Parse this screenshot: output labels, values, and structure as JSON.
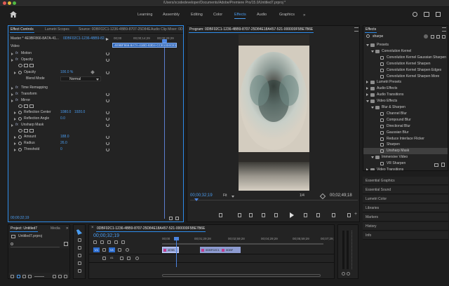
{
  "titlebar": {
    "path": "/Users/xcodedeveloper/Documents/Adobe/Premiere Pro/15.0/Untitled7.prproj *"
  },
  "workspaces": [
    "Learning",
    "Assembly",
    "Editing",
    "Color",
    "Effects",
    "Audio",
    "Graphics"
  ],
  "active_workspace": "Effects",
  "effect_controls": {
    "tabs": [
      "Effect Controls",
      "Lumetri Scopes",
      "Source: 0DBF02C1-1236-4BB9-8707-25D84E18A457-521-0000",
      "Audio Clip Mixer: 0DBF02C1-1236-4BB9-8707-25D84E18A457-521-00008"
    ],
    "source_label": "Master * 4E9BF866-8A7A-41...",
    "seq_label": "0DBF02C1-1236-4BB9-82...",
    "times": [
      "00;00",
      "00;00;14;29",
      "00;00;29;29"
    ],
    "clip_label": "4E9BF866-8A7A-41BD-83D4-CCE1324CE10F",
    "section": "Video",
    "rows": {
      "motion": "Motion",
      "opacity": "Opacity",
      "opacity_label": "Opacity",
      "opacity_value": "100.0 %",
      "blend_label": "Blend Mode",
      "blend_value": "Normal",
      "time_remap": "Time Remapping",
      "transform": "Transform",
      "mirror": "Mirror",
      "refl_center": "Reflection Center",
      "refl_center_x": "1080.0",
      "refl_center_y": "1920.0",
      "refl_angle": "Reflection Angle",
      "refl_angle_value": "0.0",
      "unsharp": "Unsharp Mask",
      "amount": "Amount",
      "amount_value": "188.0",
      "radius": "Radius",
      "radius_value": "26.0",
      "threshold": "Threshold",
      "threshold_value": "0"
    },
    "timecode": "00;00;32;19"
  },
  "program": {
    "title": "Program: 0DBF02C1-1236-4BB9-8707-25D84E18A457-521-000000F5BE7B6E",
    "timecode": "00;00;32;19",
    "fit": "Fit",
    "ratio": "1/4",
    "duration": "00;02;49;18"
  },
  "effects": {
    "title": "Effects",
    "search": "sharpe",
    "items": [
      {
        "label": "Presets",
        "indent": 0,
        "type": "folder",
        "open": true
      },
      {
        "label": "Convolution Kernel",
        "indent": 1,
        "type": "folder",
        "open": true
      },
      {
        "label": "Convolution Kernel Gaussian Sharpen",
        "indent": 2,
        "type": "fx"
      },
      {
        "label": "Convolution Kernel Sharpen",
        "indent": 2,
        "type": "fx"
      },
      {
        "label": "Convolution Kernel Sharpen Edges",
        "indent": 2,
        "type": "fx"
      },
      {
        "label": "Convolution Kernel Sharpen More",
        "indent": 2,
        "type": "fx"
      },
      {
        "label": "Lumetri Presets",
        "indent": 0,
        "type": "folder",
        "open": false
      },
      {
        "label": "Audio Effects",
        "indent": 0,
        "type": "folder",
        "open": false
      },
      {
        "label": "Audio Transitions",
        "indent": 0,
        "type": "folder",
        "open": false
      },
      {
        "label": "Video Effects",
        "indent": 0,
        "type": "folder",
        "open": true
      },
      {
        "label": "Blur & Sharpen",
        "indent": 1,
        "type": "folder",
        "open": true
      },
      {
        "label": "Channel Blur",
        "indent": 2,
        "type": "fx"
      },
      {
        "label": "Compound Blur",
        "indent": 2,
        "type": "fx"
      },
      {
        "label": "Directional Blur",
        "indent": 2,
        "type": "fx"
      },
      {
        "label": "Gaussian Blur",
        "indent": 2,
        "type": "fx"
      },
      {
        "label": "Reduce Interlace Flicker",
        "indent": 2,
        "type": "fx"
      },
      {
        "label": "Sharpen",
        "indent": 2,
        "type": "fx"
      },
      {
        "label": "Unsharp Mask",
        "indent": 2,
        "type": "fx",
        "selected": true
      },
      {
        "label": "Immersive Video",
        "indent": 1,
        "type": "folder",
        "open": true
      },
      {
        "label": "VR Sharpen",
        "indent": 2,
        "type": "fx"
      },
      {
        "label": "Video Transitions",
        "indent": 0,
        "type": "folder",
        "open": false
      }
    ],
    "menu": [
      "Essential Graphics",
      "Essential Sound",
      "Lumetri Color",
      "Libraries",
      "Markers",
      "History",
      "Info"
    ]
  },
  "project": {
    "tabs": [
      "Project: Untitled7",
      "Media"
    ],
    "file": "Untitled7.prproj"
  },
  "timeline": {
    "title": "0DBF02C1-1236-4BB9-8707-25D84E18A457-521-000000F5BE7B6E",
    "timecode": "00;00;32;19",
    "ruler": [
      "00;00",
      "00;01;29;28",
      "00;02;59;28",
      "00;04;29;29",
      "00;05;59;29",
      "00;07;29;29"
    ],
    "tracks": [
      "V1",
      "A1"
    ],
    "clip_a": "4E9B",
    "clip_b": "0DBF02C1",
    "clip_c": "0DBF"
  },
  "colors": {
    "accent": "#2d8ceb",
    "clip": "#8fa3d6",
    "bg": "#1d1d1d"
  }
}
